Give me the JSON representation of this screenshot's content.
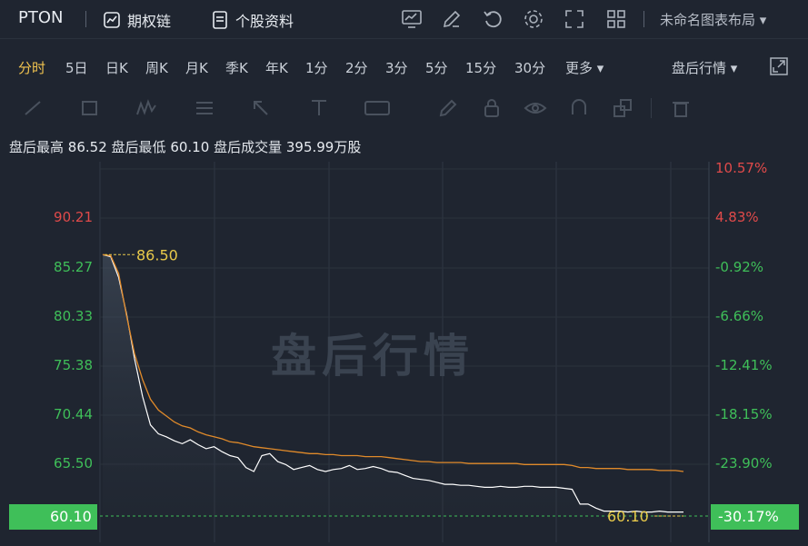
{
  "header": {
    "ticker": "PTON",
    "options_chain": "期权链",
    "stock_profile": "个股资料",
    "layout_name": "未命名图表布局"
  },
  "timeframes": {
    "items": [
      "分时",
      "5日",
      "日K",
      "周K",
      "月K",
      "季K",
      "年K",
      "1分",
      "2分",
      "3分",
      "5分",
      "15分",
      "30分",
      "更多"
    ],
    "active": "分时",
    "session_selector": "盘后行情"
  },
  "stats": {
    "high_label": "盘后最高",
    "high_value": "86.52",
    "low_label": "盘后最低",
    "low_value": "60.10",
    "volume_label": "盘后成交量",
    "volume_value": "395.99万股"
  },
  "watermark": "盘后行情",
  "colors": {
    "up": "#e04a4a",
    "down": "#3fbf59",
    "price_line": "#ffffff",
    "avg_line": "#e08a2a",
    "marker": "#e8c94a",
    "background": "#1f2530"
  },
  "chart_data": {
    "type": "line",
    "y_left_ticks": [
      "90.21",
      "85.27",
      "80.33",
      "75.38",
      "70.44",
      "65.50",
      "60.10"
    ],
    "y_right_ticks": [
      "10.57%",
      "4.83%",
      "-0.92%",
      "-6.66%",
      "-12.41%",
      "-18.15%",
      "-23.90%",
      "-30.17%"
    ],
    "ylim": [
      60.1,
      95.15
    ],
    "annotations": {
      "high": "86.50",
      "low": "60.10"
    },
    "current_price": "60.10",
    "current_change": "-30.17%",
    "series": [
      {
        "values": [
          86.5,
          86.3,
          84.2,
          80.5,
          76.0,
          72.2,
          69.3,
          68.4,
          68.1,
          67.7,
          67.4,
          67.8,
          67.3,
          66.9,
          67.1,
          66.6,
          66.2,
          66.0,
          65.0,
          64.6,
          66.2,
          66.4,
          65.6,
          65.3,
          64.8,
          65.0,
          65.2,
          64.8,
          64.6,
          64.8,
          64.9,
          65.2,
          64.8,
          64.9,
          65.1,
          64.9,
          64.6,
          64.5,
          64.2,
          63.9,
          63.8,
          63.7,
          63.5,
          63.3,
          63.3,
          63.2,
          63.2,
          63.1,
          63.0,
          63.0,
          63.1,
          63.0,
          63.0,
          63.1,
          63.1,
          63.0,
          63.0,
          63.0,
          62.9,
          62.8,
          61.3,
          61.3,
          60.9,
          60.6,
          60.6,
          60.6,
          60.5,
          60.6,
          60.5,
          60.5,
          60.6,
          60.5,
          60.5,
          60.5
        ]
      },
      {
        "values": [
          86.5,
          86.4,
          84.6,
          80.3,
          76.5,
          73.9,
          71.9,
          70.8,
          70.2,
          69.6,
          69.2,
          69.0,
          68.6,
          68.3,
          68.1,
          67.9,
          67.6,
          67.5,
          67.3,
          67.1,
          67.0,
          66.9,
          66.8,
          66.7,
          66.6,
          66.5,
          66.4,
          66.4,
          66.3,
          66.3,
          66.2,
          66.2,
          66.2,
          66.1,
          66.1,
          66.1,
          66.0,
          65.9,
          65.8,
          65.7,
          65.6,
          65.6,
          65.5,
          65.5,
          65.5,
          65.5,
          65.4,
          65.4,
          65.4,
          65.4,
          65.4,
          65.4,
          65.4,
          65.3,
          65.3,
          65.3,
          65.3,
          65.3,
          65.3,
          65.2,
          65.0,
          65.0,
          64.9,
          64.9,
          64.9,
          64.9,
          64.8,
          64.8,
          64.8,
          64.8,
          64.7,
          64.7,
          64.7,
          64.6
        ]
      }
    ]
  }
}
